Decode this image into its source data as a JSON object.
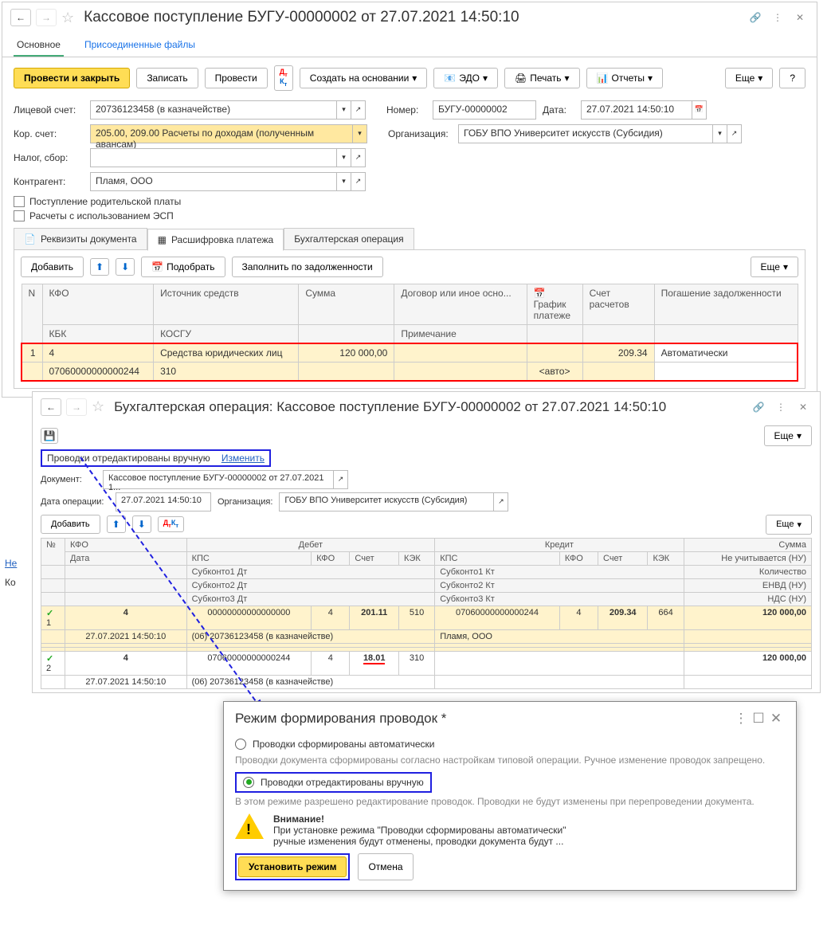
{
  "win1": {
    "title": "Кассовое поступление БУГУ-00000002 от 27.07.2021 14:50:10",
    "tabs_top": {
      "main": "Основное",
      "files": "Присоединенные файлы"
    },
    "cmd": {
      "post_close": "Провести и закрыть",
      "save": "Записать",
      "post": "Провести",
      "create_based": "Создать на основании",
      "edo": "ЭДО",
      "print": "Печать",
      "reports": "Отчеты",
      "more": "Еще"
    },
    "form": {
      "account_lbl": "Лицевой счет:",
      "account_val": "20736123458 (в казначействе)",
      "cor_lbl": "Кор. счет:",
      "cor_val": "205.00, 209.00 Расчеты по доходам (полученным авансам)",
      "tax_lbl": "Налог, сбор:",
      "tax_val": "",
      "contr_lbl": "Контрагент:",
      "contr_val": "Пламя, ООО",
      "parent_pay": "Поступление родительской платы",
      "esp": "Расчеты с использованием ЭСП",
      "num_lbl": "Номер:",
      "num_val": "БУГУ-00000002",
      "date_lbl": "Дата:",
      "date_val": "27.07.2021 14:50:10",
      "org_lbl": "Организация:",
      "org_val": "ГОБУ ВПО Университет искусств (Субсидия)"
    },
    "tabs_mid": {
      "req": "Реквизиты документа",
      "split": "Расшифровка платежа",
      "acc": "Бухгалтерская операция"
    },
    "split_cmd": {
      "add": "Добавить",
      "pick": "Подобрать",
      "fill_debt": "Заполнить по задолженности",
      "more": "Еще"
    },
    "split_hdr": {
      "n": "N",
      "kfo": "КФО",
      "source": "Источник средств",
      "sum": "Сумма",
      "contract": "Договор или иное осно...",
      "schedule_icon": "График платеже",
      "acct": "Счет расчетов",
      "repay": "Погашение задолженности",
      "kbk": "КБК",
      "kosgu": "КОСГУ",
      "note": "Примечание"
    },
    "split_row": {
      "n": "1",
      "kfo": "4",
      "source": "Средства юридических лиц",
      "sum": "120 000,00",
      "acct": "209.34",
      "repay": "Автоматически",
      "kbk": "07060000000000244",
      "kosgu": "310",
      "schedule": "<авто>"
    }
  },
  "win2": {
    "title": "Бухгалтерская операция: Кассовое поступление БУГУ-00000002 от 27.07.2021 14:50:10",
    "more": "Еще",
    "manual_label": "Проводки отредактированы вручную",
    "edit_link": "Изменить",
    "doc_lbl": "Документ:",
    "doc_val": "Кассовое поступление БУГУ-00000002 от 27.07.2021 1...",
    "date_lbl": "Дата операции:",
    "date_val": "27.07.2021 14:50:10",
    "org_lbl": "Организация:",
    "org_val": "ГОБУ ВПО Университет искусств (Субсидия)",
    "add": "Добавить",
    "hdr": {
      "n": "№",
      "kfo": "КФО",
      "debit": "Дебет",
      "credit": "Кредит",
      "sum": "Сумма",
      "date": "Дата",
      "kps": "КПС",
      "kfo2": "КФО",
      "acct": "Счет",
      "kek": "КЭК",
      "qty": "Количество",
      "sub1": "Субконто1 Дт",
      "sub2": "Субконто2 Дт",
      "sub3": "Субконто3 Дт",
      "sub1k": "Субконто1 Кт",
      "sub2k": "Субконто2 Кт",
      "sub3k": "Субконто3 Кт",
      "nu": "Не учитывается (НУ)",
      "envd": "ЕНВД (НУ)",
      "nds": "НДС (НУ)"
    },
    "rows": [
      {
        "n": "1",
        "kfo": "4",
        "date": "27.07.2021 14:50:10",
        "d_kps": "00000000000000000",
        "d_kfo": "4",
        "d_acct": "201.11",
        "d_kek": "510",
        "d_sub1": "(06) 20736123458 (в казначействе)",
        "c_kps": "07060000000000244",
        "c_kfo": "4",
        "c_acct": "209.34",
        "c_kek": "664",
        "c_sub1": "Пламя, ООО",
        "sum": "120 000,00"
      },
      {
        "n": "2",
        "kfo": "4",
        "date": "27.07.2021 14:50:10",
        "d_kps": "07060000000000244",
        "d_kfo": "4",
        "d_acct": "18.01",
        "d_kek": "310",
        "d_sub1": "(06) 20736123458 (в казначействе)",
        "sum": "120 000,00"
      }
    ]
  },
  "modal": {
    "title": "Режим формирования проводок *",
    "opt_auto": "Проводки сформированы автоматически",
    "hint_auto": "Проводки документа сформированы согласно настройкам типовой операции. Ручное изменение проводок запрещено.",
    "opt_manual": "Проводки отредактированы вручную",
    "hint_manual": "В этом режиме разрешено редактирование проводок. Проводки не будут изменены при перепроведении документа.",
    "warn_title": "Внимание!",
    "warn_line1": "При установке режима \"Проводки сформированы автоматически\"",
    "warn_line2": "ручные изменения будут отменены, проводки документа будут ...",
    "set": "Установить режим",
    "cancel": "Отмена"
  },
  "footer": {
    "ne": "Не",
    "ko": "Ко"
  }
}
